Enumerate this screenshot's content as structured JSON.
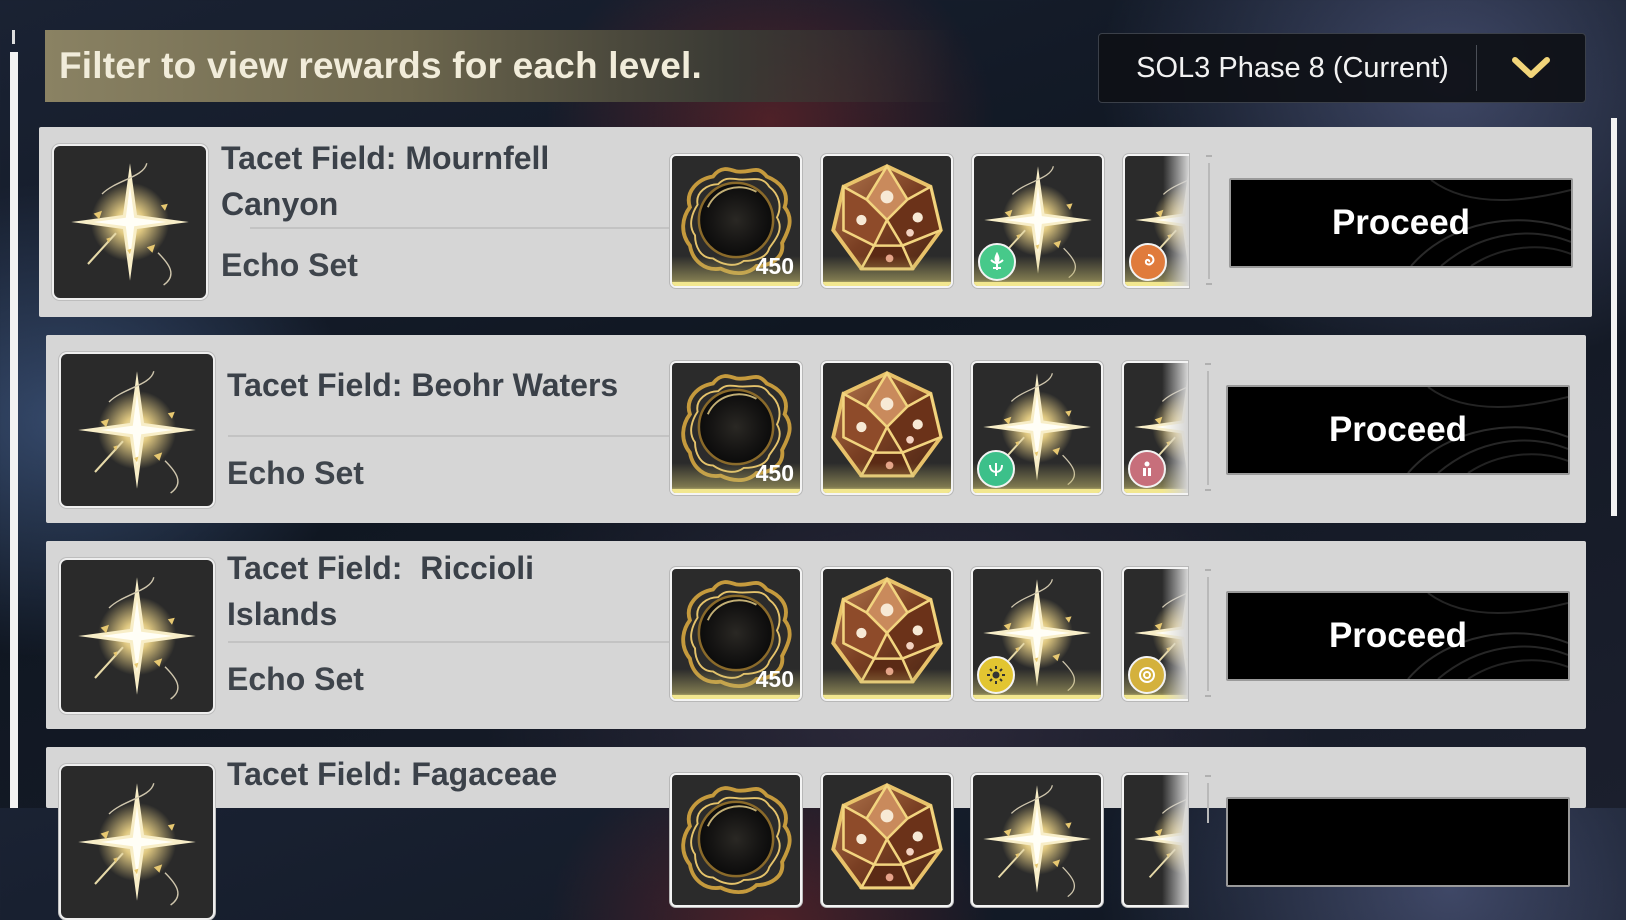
{
  "header": {
    "filter_text": "Filter to view rewards for each level.",
    "phase_select": {
      "selected": "SOL3 Phase 8 (Current)"
    }
  },
  "fields": [
    {
      "title_line1": "Tacet Field: Mournfell",
      "title_line2": "Canyon",
      "subtitle": "Echo Set",
      "rewards": [
        {
          "icon": "dark-core-icon",
          "count": "450"
        },
        {
          "icon": "dice-crystal-icon",
          "count": ""
        },
        {
          "icon": "sonata-echo-icon",
          "badge_icon": "fleur-badge-icon",
          "badge_color": "#47c98a"
        },
        {
          "icon": "sonata-echo-icon",
          "badge_icon": "swirl-badge-icon",
          "badge_color": "#e07b3c"
        }
      ],
      "action": "Proceed"
    },
    {
      "title_line1": "Tacet Field: Beohr Waters",
      "title_line2": "",
      "subtitle": "Echo Set",
      "rewards": [
        {
          "icon": "dark-core-icon",
          "count": "450"
        },
        {
          "icon": "dice-crystal-icon",
          "count": ""
        },
        {
          "icon": "sonata-echo-icon",
          "badge_icon": "trident-badge-icon",
          "badge_color": "#3cc08a"
        },
        {
          "icon": "sonata-echo-icon",
          "badge_icon": "figure-badge-icon",
          "badge_color": "#c76f7b"
        }
      ],
      "action": "Proceed"
    },
    {
      "title_line1": "Tacet Field:  Riccioli",
      "title_line2": "Islands",
      "subtitle": "Echo Set",
      "rewards": [
        {
          "icon": "dark-core-icon",
          "count": "450"
        },
        {
          "icon": "dice-crystal-icon",
          "count": ""
        },
        {
          "icon": "sonata-echo-icon",
          "badge_icon": "sun-badge-icon",
          "badge_color": "#e2c531"
        },
        {
          "icon": "sonata-echo-icon",
          "badge_icon": "ring-badge-icon",
          "badge_color": "#d4b13c"
        }
      ],
      "action": "Proceed"
    },
    {
      "title_line1": "Tacet Field: Fagaceae",
      "title_line2": "",
      "subtitle": "",
      "rewards": [],
      "action": ""
    }
  ],
  "colors": {
    "card_bg": "#d6d6d6",
    "title": "#3b4149",
    "accent_gold": "#f2d57a",
    "button_bg": "#000000"
  }
}
